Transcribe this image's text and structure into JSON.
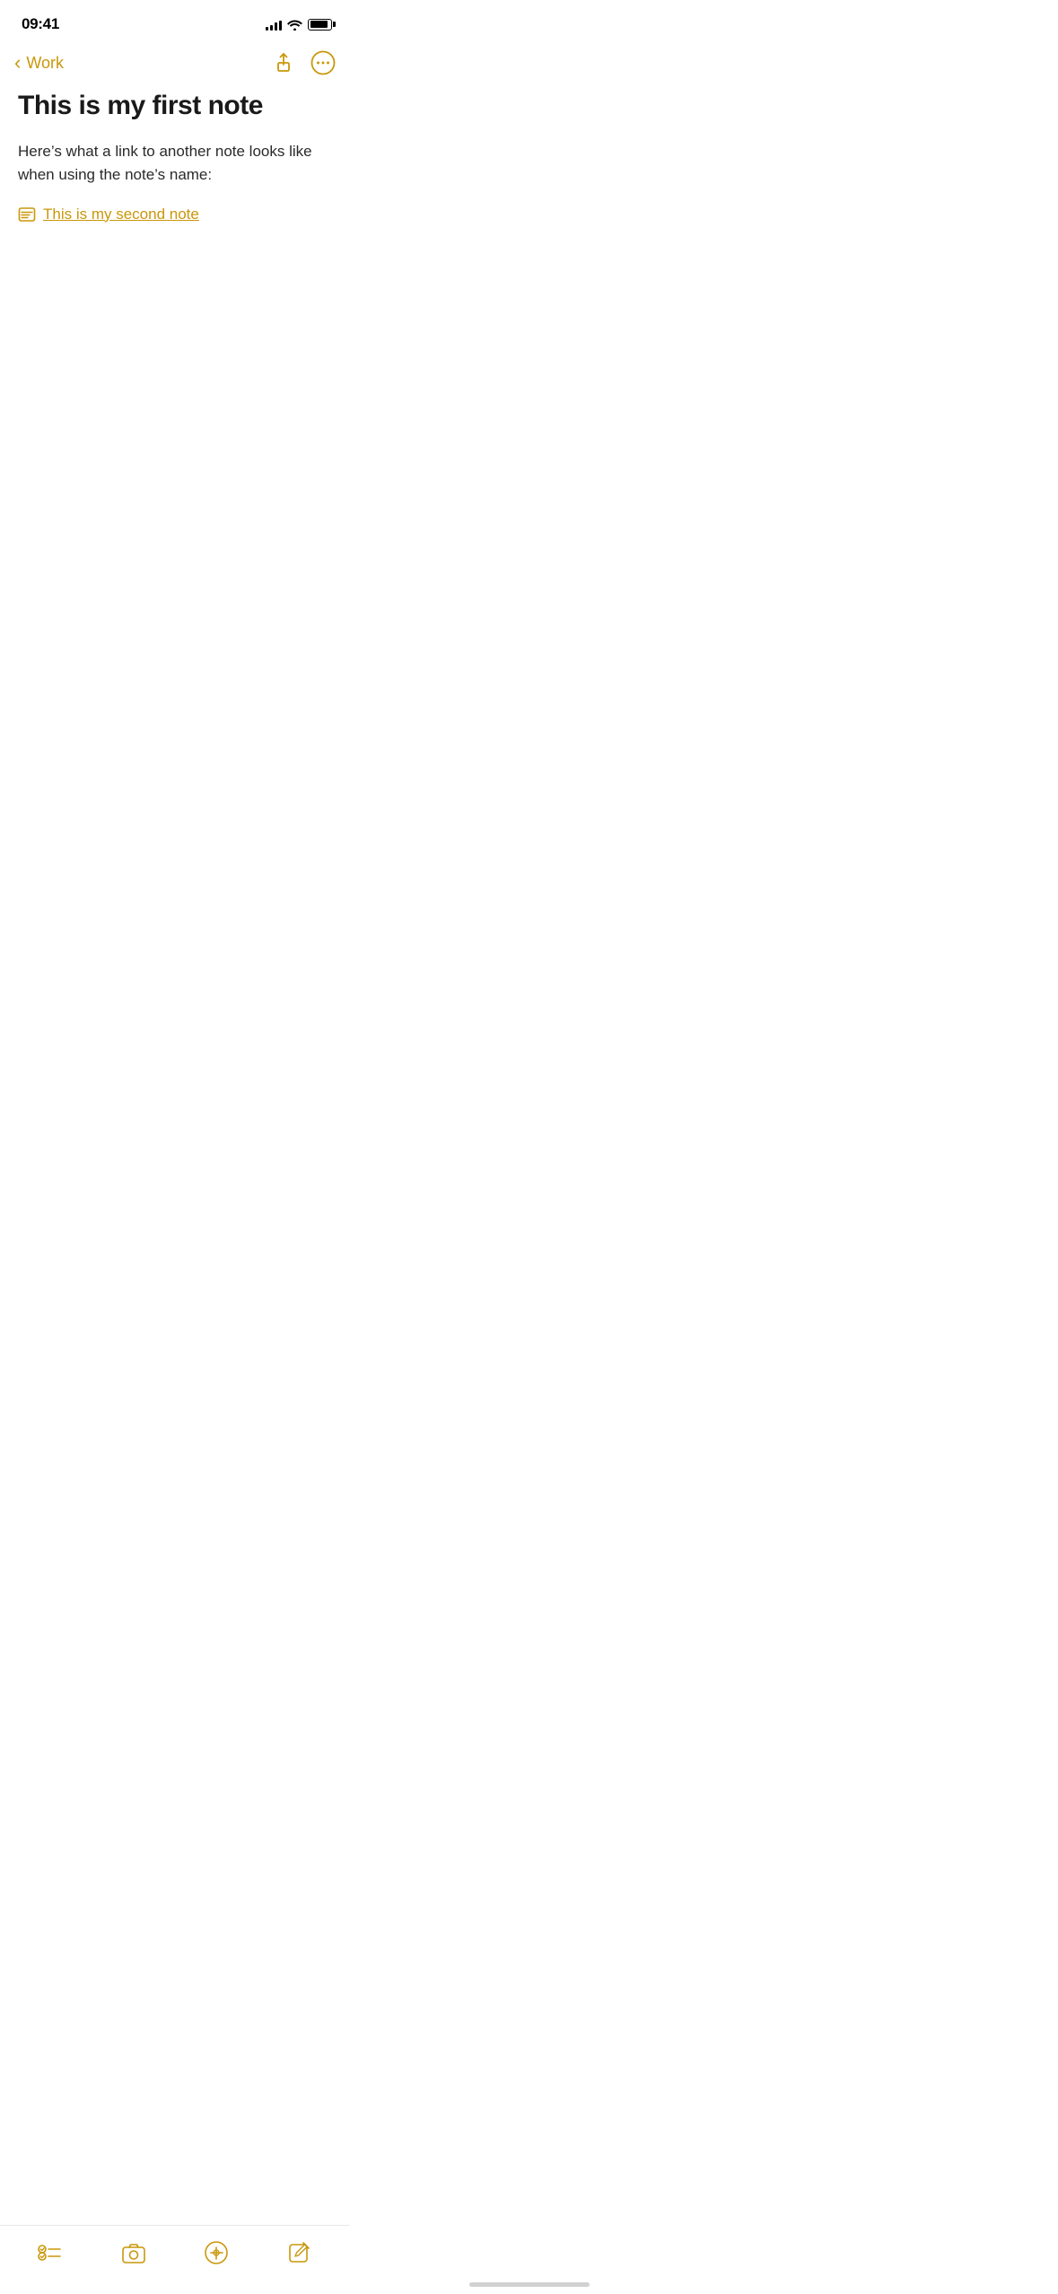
{
  "status_bar": {
    "time": "09:41",
    "signal_bars": [
      4,
      6,
      9,
      11,
      13
    ],
    "wifi": true,
    "battery_level": 90
  },
  "nav": {
    "back_label": "Work",
    "share_label": "Share",
    "more_label": "More options"
  },
  "note": {
    "title": "This is my first note",
    "body": "Here’s what a link to another note looks like when using the note’s name:",
    "link_text": "This is my second note"
  },
  "toolbar": {
    "checklist_label": "Checklist",
    "camera_label": "Camera",
    "markup_label": "Markup",
    "compose_label": "Compose"
  },
  "colors": {
    "accent": "#c9970a",
    "text_primary": "#1a1a1a",
    "text_body": "#2a2a2a"
  }
}
